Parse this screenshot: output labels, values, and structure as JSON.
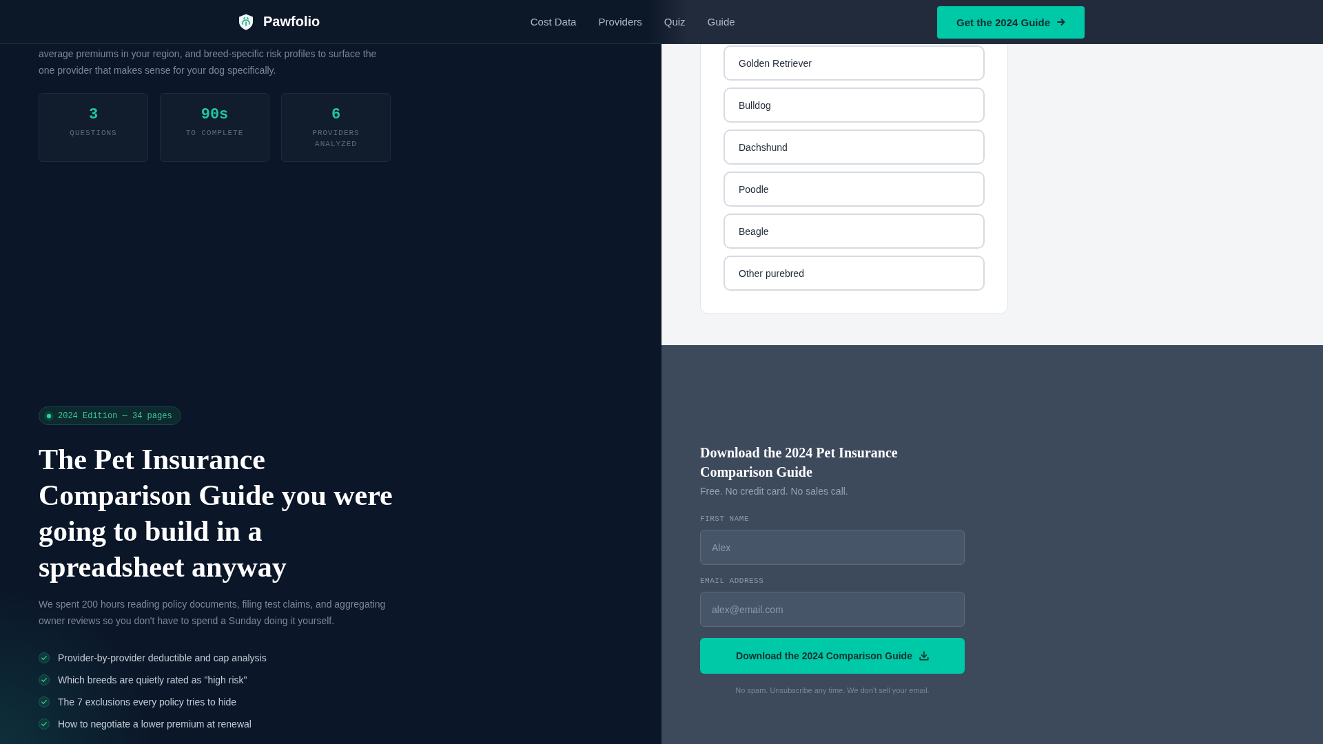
{
  "nav": {
    "brand": "Pawfolio",
    "links": [
      {
        "label": "Cost Data"
      },
      {
        "label": "Providers"
      },
      {
        "label": "Quiz"
      },
      {
        "label": "Guide"
      }
    ],
    "cta": {
      "label": "Get the 2024 Guide"
    }
  },
  "intro": {
    "text": "average premiums in your region, and breed-specific risk profiles to surface the one provider that makes sense for your dog specifically.",
    "stats": [
      {
        "value": "3",
        "label": "QUESTIONS"
      },
      {
        "value": "90s",
        "label": "TO COMPLETE"
      },
      {
        "value": "6",
        "label": "PROVIDERS ANALYZED"
      }
    ]
  },
  "quiz": {
    "options": [
      {
        "label": "Golden Retriever",
        "selected": false
      },
      {
        "label": "Bulldog",
        "selected": false
      },
      {
        "label": "Dachshund",
        "selected": false
      },
      {
        "label": "Poodle",
        "selected": false
      },
      {
        "label": "Beagle",
        "selected": false
      },
      {
        "label": "Other purebred",
        "selected": false
      }
    ]
  },
  "guide": {
    "badge": "2024 Edition — 34 pages",
    "title": "The Pet Insurance Comparison Guide you were going to build in a spreadsheet anyway",
    "description": "We spent 200 hours reading policy documents, filing test claims, and aggregating owner reviews so you don't have to spend a Sunday doing it yourself.",
    "features": [
      "Provider-by-provider deductible and cap analysis",
      "Which breeds are quietly rated as \"high risk\"",
      "The 7 exclusions every policy tries to hide",
      "How to negotiate a lower premium at renewal"
    ]
  },
  "form": {
    "title": "Download the 2024 Pet Insurance Comparison Guide",
    "subtitle": "Free. No credit card. No sales call.",
    "fields": [
      {
        "label": "FIRST NAME",
        "placeholder": "Alex"
      },
      {
        "label": "EMAIL ADDRESS",
        "placeholder": "alex@email.com"
      }
    ],
    "submit": "Download the 2024 Comparison Guide",
    "note": "No spam. Unsubscribe any time. We don't sell your email."
  }
}
